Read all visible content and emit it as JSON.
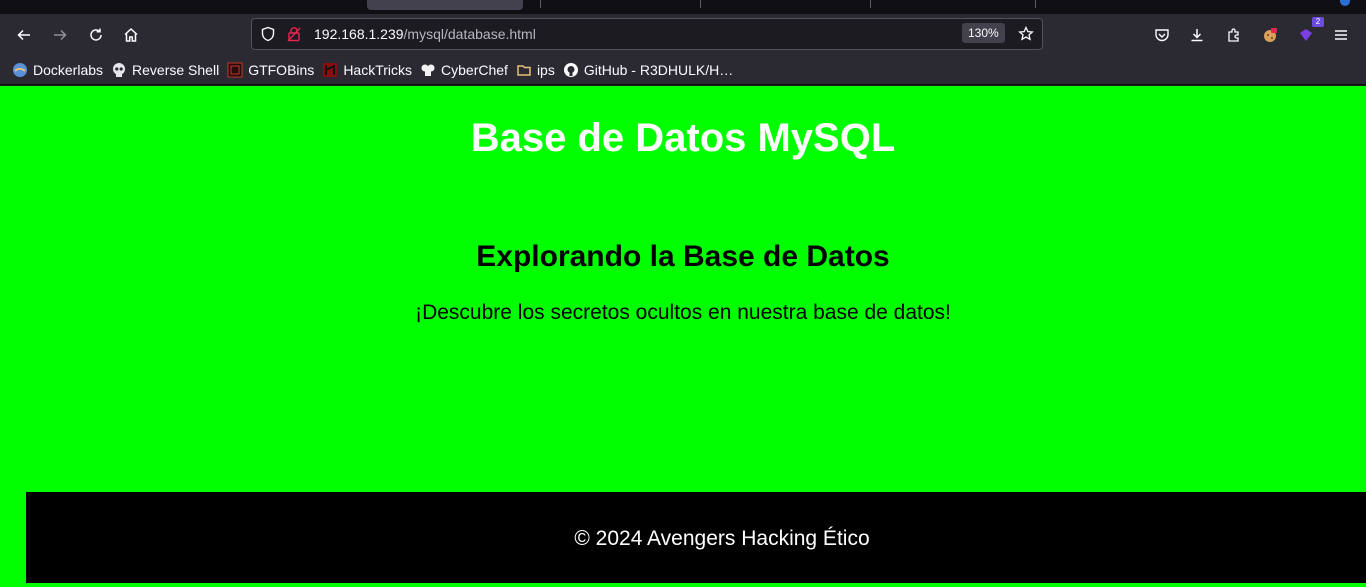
{
  "browser": {
    "nav": {
      "back_icon": "arrow-left-icon",
      "forward_icon": "arrow-right-icon",
      "reload_icon": "reload-icon",
      "home_icon": "home-icon"
    },
    "urlbar": {
      "host": "192.168.1.239",
      "path": "/mysql/database.html",
      "zoom": "130%"
    },
    "toolbar": {
      "extension_badge": "2"
    },
    "bookmarks": [
      {
        "label": "Dockerlabs",
        "icon": "dockerlabs-icon"
      },
      {
        "label": "Reverse Shell",
        "icon": "skull-icon"
      },
      {
        "label": "GTFOBins",
        "icon": "gtfobins-icon"
      },
      {
        "label": "HackTricks",
        "icon": "hacktricks-icon"
      },
      {
        "label": "CyberChef",
        "icon": "chef-icon"
      },
      {
        "label": "ips",
        "icon": "folder-icon"
      },
      {
        "label": "GitHub - R3DHULK/H…",
        "icon": "github-icon"
      }
    ]
  },
  "page": {
    "title": "Base de Datos MySQL",
    "subtitle": "Explorando la Base de Datos",
    "description": "¡Descubre los secretos ocultos en nuestra base de datos!",
    "footer": "© 2024 Avengers Hacking Ético"
  },
  "colors": {
    "page_background": "#00ff00",
    "footer_background": "#000000",
    "title_color": "#ffffff"
  }
}
